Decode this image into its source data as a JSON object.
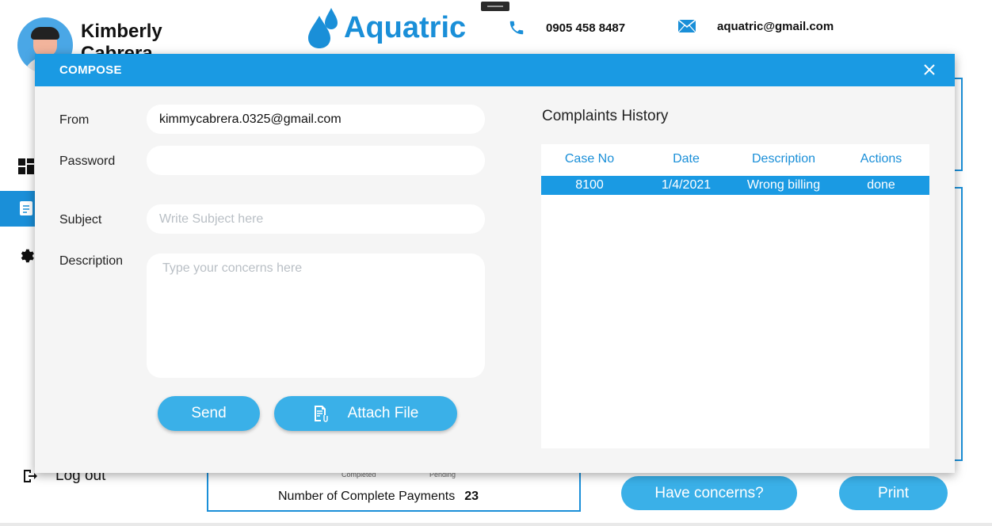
{
  "user": {
    "first_name": "Kimberly",
    "last_name": "Cabrera"
  },
  "brand": {
    "name": "Aquatric",
    "phone": "0905 458 8487",
    "email": "aquatric@gmail.com"
  },
  "sidebar": {
    "logout_label": "Log out"
  },
  "payments": {
    "completed_label": "Completed",
    "pending_label": "Pending",
    "complete_label": "Number of Complete Payments",
    "complete_count": "23"
  },
  "actions": {
    "concerns_label": "Have concerns?",
    "print_label": "Print"
  },
  "compose": {
    "title": "COMPOSE",
    "from_label": "From",
    "from_value": "kimmycabrera.0325@gmail.com",
    "password_label": "Password",
    "password_value": "",
    "subject_label": "Subject",
    "subject_placeholder": "Write Subject here",
    "description_label": "Description",
    "description_placeholder": "Type your concerns here",
    "send_label": "Send",
    "attach_label": "Attach File"
  },
  "history": {
    "title": "Complaints History",
    "columns": [
      "Case No",
      "Date",
      "Description",
      "Actions"
    ],
    "rows": [
      {
        "case_no": "8100",
        "date": "1/4/2021",
        "description": "Wrong billing",
        "action": "done"
      }
    ]
  },
  "colors": {
    "accent": "#1a9ae3",
    "button": "#3ab0e8",
    "field_bg": "#ffffff",
    "modal_bg": "#f5f5f5"
  },
  "icons": {
    "close": "close-icon",
    "phone": "phone-icon",
    "mail": "mail-icon",
    "logo": "water-drop-icon",
    "attach": "attach-file-icon",
    "dashboard": "dashboard-icon",
    "document": "document-icon",
    "settings": "gear-icon",
    "logout": "logout-icon"
  }
}
